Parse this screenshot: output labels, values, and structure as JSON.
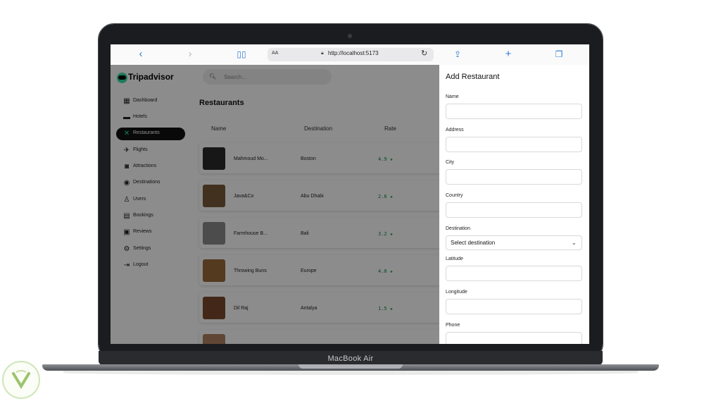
{
  "device": {
    "label": "MacBook Air"
  },
  "browser": {
    "text_size": "AA",
    "url": "http://localhost:5173",
    "icons": [
      "back-icon",
      "forward-icon",
      "bookmarks-icon",
      "lock-icon",
      "reload-icon",
      "share-icon",
      "new-tab-icon",
      "tabs-icon"
    ]
  },
  "app": {
    "brand": "Tripadvisor",
    "brand_color": "#34e0a1",
    "search_placeholder": "Search...",
    "nav": [
      {
        "label": "Dashboard",
        "icon": "dashboard-icon",
        "glyph": "▦",
        "active": false
      },
      {
        "label": "Hotels",
        "icon": "bed-icon",
        "glyph": "▬",
        "active": false
      },
      {
        "label": "Restaurants",
        "icon": "utensils-icon",
        "glyph": "✕",
        "active": true
      },
      {
        "label": "Flights",
        "icon": "plane-icon",
        "glyph": "✈",
        "active": false
      },
      {
        "label": "Attractions",
        "icon": "camera-icon",
        "glyph": "◙",
        "active": false
      },
      {
        "label": "Destinations",
        "icon": "map-pin-icon",
        "glyph": "◉",
        "active": false
      },
      {
        "label": "Users",
        "icon": "user-icon",
        "glyph": "♙",
        "active": false
      },
      {
        "label": "Bookings",
        "icon": "ticket-icon",
        "glyph": "▤",
        "active": false
      },
      {
        "label": "Reviews",
        "icon": "review-icon",
        "glyph": "▣",
        "active": false
      },
      {
        "label": "Settings",
        "icon": "gear-icon",
        "glyph": "⚙",
        "active": false
      },
      {
        "label": "Logout",
        "icon": "logout-icon",
        "glyph": "⇥",
        "active": false
      }
    ]
  },
  "restaurants": {
    "title": "Restaurants",
    "columns": [
      "Name",
      "Destination",
      "Rate"
    ],
    "rows": [
      {
        "name": "Mahmoud Mo...",
        "destination": "Boston",
        "rate": "4.9 ★",
        "thumb": "#2b2b2b"
      },
      {
        "name": "Java&Co",
        "destination": "Abu Dhabi",
        "rate": "2.6 ★",
        "thumb": "#7a5a3a"
      },
      {
        "name": "Farmhouse B...",
        "destination": "Bali",
        "rate": "3.2 ★",
        "thumb": "#8a8a8a"
      },
      {
        "name": "Throwing Buns",
        "destination": "Europe",
        "rate": "4.0 ★",
        "thumb": "#9a6a3a"
      },
      {
        "name": "Dil Raj",
        "destination": "Antalya",
        "rate": "1.5 ★",
        "thumb": "#7a4a2e"
      },
      {
        "name": "",
        "destination": "",
        "rate": "",
        "thumb": "#b08060"
      }
    ]
  },
  "drawer": {
    "title": "Add Restaurant",
    "fields": {
      "name": "Name",
      "address": "Address",
      "city": "City",
      "country": "Country",
      "destination": "Destination",
      "destination_value": "Select destination",
      "latitude": "Latitude",
      "longitude": "Longitude",
      "phone": "Phone"
    }
  }
}
